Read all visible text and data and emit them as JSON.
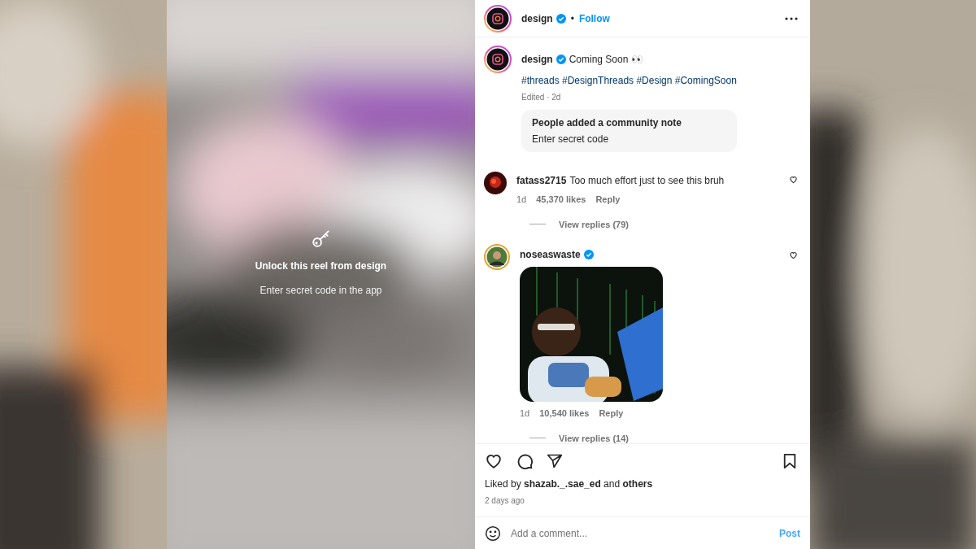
{
  "reel_lock": {
    "title": "Unlock this reel from design",
    "subtitle": "Enter secret code in the app"
  },
  "header": {
    "username": "design",
    "verified": true,
    "separator": "•",
    "follow": "Follow"
  },
  "caption": {
    "username": "design",
    "verified": true,
    "text": "Coming Soon 👀",
    "hashtags": "#threads #DesignThreads #Design #ComingSoon",
    "meta": "Edited · 2d"
  },
  "community_note": {
    "title": "People added a community note",
    "text": "Enter secret code"
  },
  "comments": [
    {
      "kind": "text",
      "username": "fatass2715",
      "verified": false,
      "text": "Too much effort just to see this bruh",
      "time": "1d",
      "likes": "45,370 likes",
      "reply": "Reply",
      "view_replies": "View replies (79)"
    },
    {
      "kind": "gif",
      "username": "noseaswaste",
      "verified": true,
      "time": "1d",
      "likes": "10,540 likes",
      "reply": "Reply",
      "view_replies": "View replies (14)"
    }
  ],
  "liked_by": "Liked by **shazab._.sae_ed** and **others**",
  "date": "2 days ago",
  "comment_field": {
    "placeholder": "Add a comment...",
    "post": "Post"
  }
}
